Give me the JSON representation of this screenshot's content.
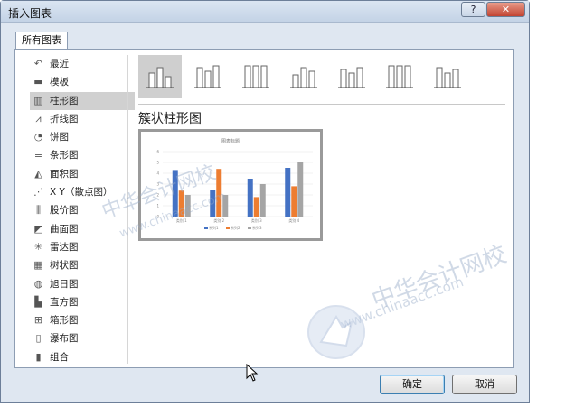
{
  "dialog": {
    "title": "插入图表",
    "help_label": "?",
    "close_label": "✕",
    "tab_label": "所有图表",
    "ok_label": "确定",
    "cancel_label": "取消"
  },
  "sidebar": {
    "items": [
      {
        "label": "最近",
        "icon": "recent-icon"
      },
      {
        "label": "模板",
        "icon": "template-folder-icon"
      },
      {
        "label": "柱形图",
        "icon": "column-chart-icon",
        "selected": true
      },
      {
        "label": "折线图",
        "icon": "line-chart-icon"
      },
      {
        "label": "饼图",
        "icon": "pie-chart-icon"
      },
      {
        "label": "条形图",
        "icon": "bar-chart-icon"
      },
      {
        "label": "面积图",
        "icon": "area-chart-icon"
      },
      {
        "label": "X Y（散点图）",
        "icon": "scatter-chart-icon"
      },
      {
        "label": "股价图",
        "icon": "stock-chart-icon"
      },
      {
        "label": "曲面图",
        "icon": "surface-chart-icon"
      },
      {
        "label": "雷达图",
        "icon": "radar-chart-icon"
      },
      {
        "label": "树状图",
        "icon": "treemap-chart-icon"
      },
      {
        "label": "旭日图",
        "icon": "sunburst-chart-icon"
      },
      {
        "label": "直方图",
        "icon": "histogram-chart-icon"
      },
      {
        "label": "箱形图",
        "icon": "box-whisker-chart-icon"
      },
      {
        "label": "瀑布图",
        "icon": "waterfall-chart-icon"
      },
      {
        "label": "组合",
        "icon": "combo-chart-icon"
      }
    ]
  },
  "main": {
    "chart_type_title": "簇状柱形图",
    "variant_count": 7
  },
  "watermark": {
    "brand": "中华会计网校",
    "url": "www.chinaacc.com"
  },
  "chart_data": {
    "type": "bar",
    "title": "图表标题",
    "categories": [
      "类别 1",
      "类别 2",
      "类别 3",
      "类别 4"
    ],
    "series": [
      {
        "name": "系列1",
        "values": [
          4.3,
          2.5,
          3.5,
          4.5
        ],
        "color": "#4472c4"
      },
      {
        "name": "系列2",
        "values": [
          2.4,
          4.4,
          1.8,
          2.8
        ],
        "color": "#ed7d31"
      },
      {
        "name": "系列3",
        "values": [
          2,
          2,
          3,
          5
        ],
        "color": "#a5a5a5"
      }
    ],
    "ylim": [
      0,
      6
    ],
    "grid": true,
    "legend": "bottom"
  }
}
